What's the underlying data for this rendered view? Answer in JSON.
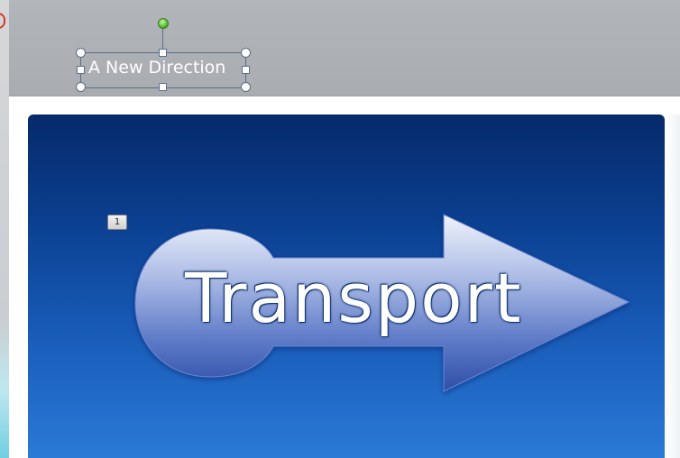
{
  "slide": {
    "title_placeholder_text": "A New Direction",
    "animation_tag": "1",
    "shape_text": "Transport"
  },
  "colors": {
    "workspace_gray": "#adb0b5",
    "slide_top": "#062a6a",
    "slide_bottom": "#2a7ad6",
    "rotation_handle": "#3db21f"
  },
  "icons": {
    "shape": "arrow-right-with-circle-tail",
    "rotate": "rotation-handle"
  }
}
